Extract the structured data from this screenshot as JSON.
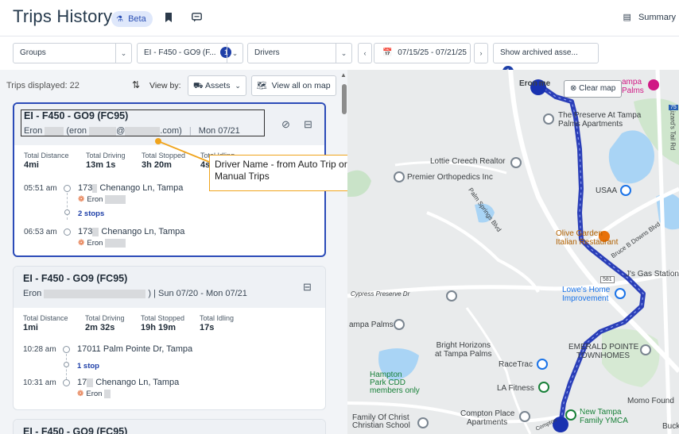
{
  "header": {
    "title": "Trips History",
    "beta": "Beta",
    "beta_icon": "flask-icon",
    "bookmark_icon": "bookmark-icon",
    "chat_icon": "chat-icon",
    "summary": "Summary"
  },
  "filters": {
    "groups": "Groups",
    "asset": "EI - F450 - GO9 (F...",
    "asset_count": "1",
    "drivers": "Drivers",
    "date_range": "07/15/25 - 07/21/25",
    "archived": "Show archived asse...",
    "archived_count": "1"
  },
  "list_header": {
    "trips_displayed": "Trips displayed: 22",
    "view_by": "View by:",
    "assets_button": "Assets",
    "view_all_button": "View all on map"
  },
  "cards": [
    {
      "title": "EI - F450 - GO9 (FC95)",
      "driver_first": "Eron",
      "email_prefix": "(eron",
      "email_domain": "@",
      "email_suffix": ".com)",
      "date": "Mon 07/21",
      "stats": [
        {
          "label": "Total Distance",
          "value": "4mi"
        },
        {
          "label": "Total Driving",
          "value": "13m 1s"
        },
        {
          "label": "Total Stopped",
          "value": "3h 20m"
        },
        {
          "label": "Total Idling",
          "value": "4s"
        }
      ],
      "start_time": "05:51 am",
      "start_addr_prefix": "173",
      "start_addr_suffix": " Chenango Ln, Tampa",
      "start_driver": "Eron",
      "stops": "2 stops",
      "end_time": "06:53 am",
      "end_addr_prefix": "173",
      "end_addr_suffix": " Chenango Ln, Tampa",
      "end_driver": "Eron"
    },
    {
      "title": "EI - F450 - GO9 (FC95)",
      "driver_first": "Eron",
      "date_suffix": ")  |  Sun 07/20 - Mon 07/21",
      "stats": [
        {
          "label": "Total Distance",
          "value": "1mi"
        },
        {
          "label": "Total Driving",
          "value": "2m 32s"
        },
        {
          "label": "Total Stopped",
          "value": "19h 19m"
        },
        {
          "label": "Total Idling",
          "value": "17s"
        }
      ],
      "start_time": "10:28 am",
      "start_addr": "17011 Palm Pointe Dr, Tampa",
      "stops": "1 stop",
      "end_time": "10:31 am",
      "end_addr_prefix": "17",
      "end_addr_suffix": " Chenango Ln, Tampa",
      "end_driver": "Eron"
    },
    {
      "title": "EI - F450 - GO9 (FC95)"
    }
  ],
  "callout": {
    "text": "Driver Name - from Auto Trip or Manual Trips"
  },
  "map": {
    "clear_map": "Clear map",
    "labels": {
      "eron_home": "Eron",
      "eron_home_2": "me",
      "tampa_palms": "ampa",
      "tampa_palms_2": "Palms",
      "preserve": "The Preserve At Tampa",
      "preserve_2": "Palms Apartments",
      "lottie": "Lottie Creech Realtor",
      "premier": "Premier Orthopedics Inc",
      "usaa": "USAA",
      "olive": "Olive Garden",
      "olive_2": "Italian Restaurant",
      "lowes": "Lowe's Home",
      "lowes_2": "Improvement",
      "js_gas": "J's Gas Station",
      "cypress": "Cypress Preserve Dr",
      "tampa_palms_left": "ampa Palms",
      "bright": "Bright Horizons",
      "bright_2": "at Tampa Palms",
      "racetrac": "RaceTrac",
      "emerald": "EMERALD POINTE",
      "emerald_2": "TOWNHOMES",
      "hampton": "Hampton",
      "hampton_2": "Park CDD",
      "hampton_3": "members only",
      "la_fitness": "LA Fitness",
      "momo": "Momo Found",
      "family": "Family Of Christ",
      "family_2": "Christian School",
      "compton": "Compton Place",
      "compton_2": "Apartments",
      "ymca": "New Tampa",
      "ymca_2": "Family YMCA",
      "buck": "Buck",
      "palm_springs": "Palm Springs Blvd",
      "bruce": "Bruce B Downs Blvd",
      "lizard": "Lizard's Tail Rd",
      "road_581": "581",
      "road_75": "75",
      "compton_rd": "Compton"
    }
  },
  "colors": {
    "accent": "#1e3fa8",
    "route": "#2b3fb8",
    "callout_border": "#f0a41c"
  }
}
